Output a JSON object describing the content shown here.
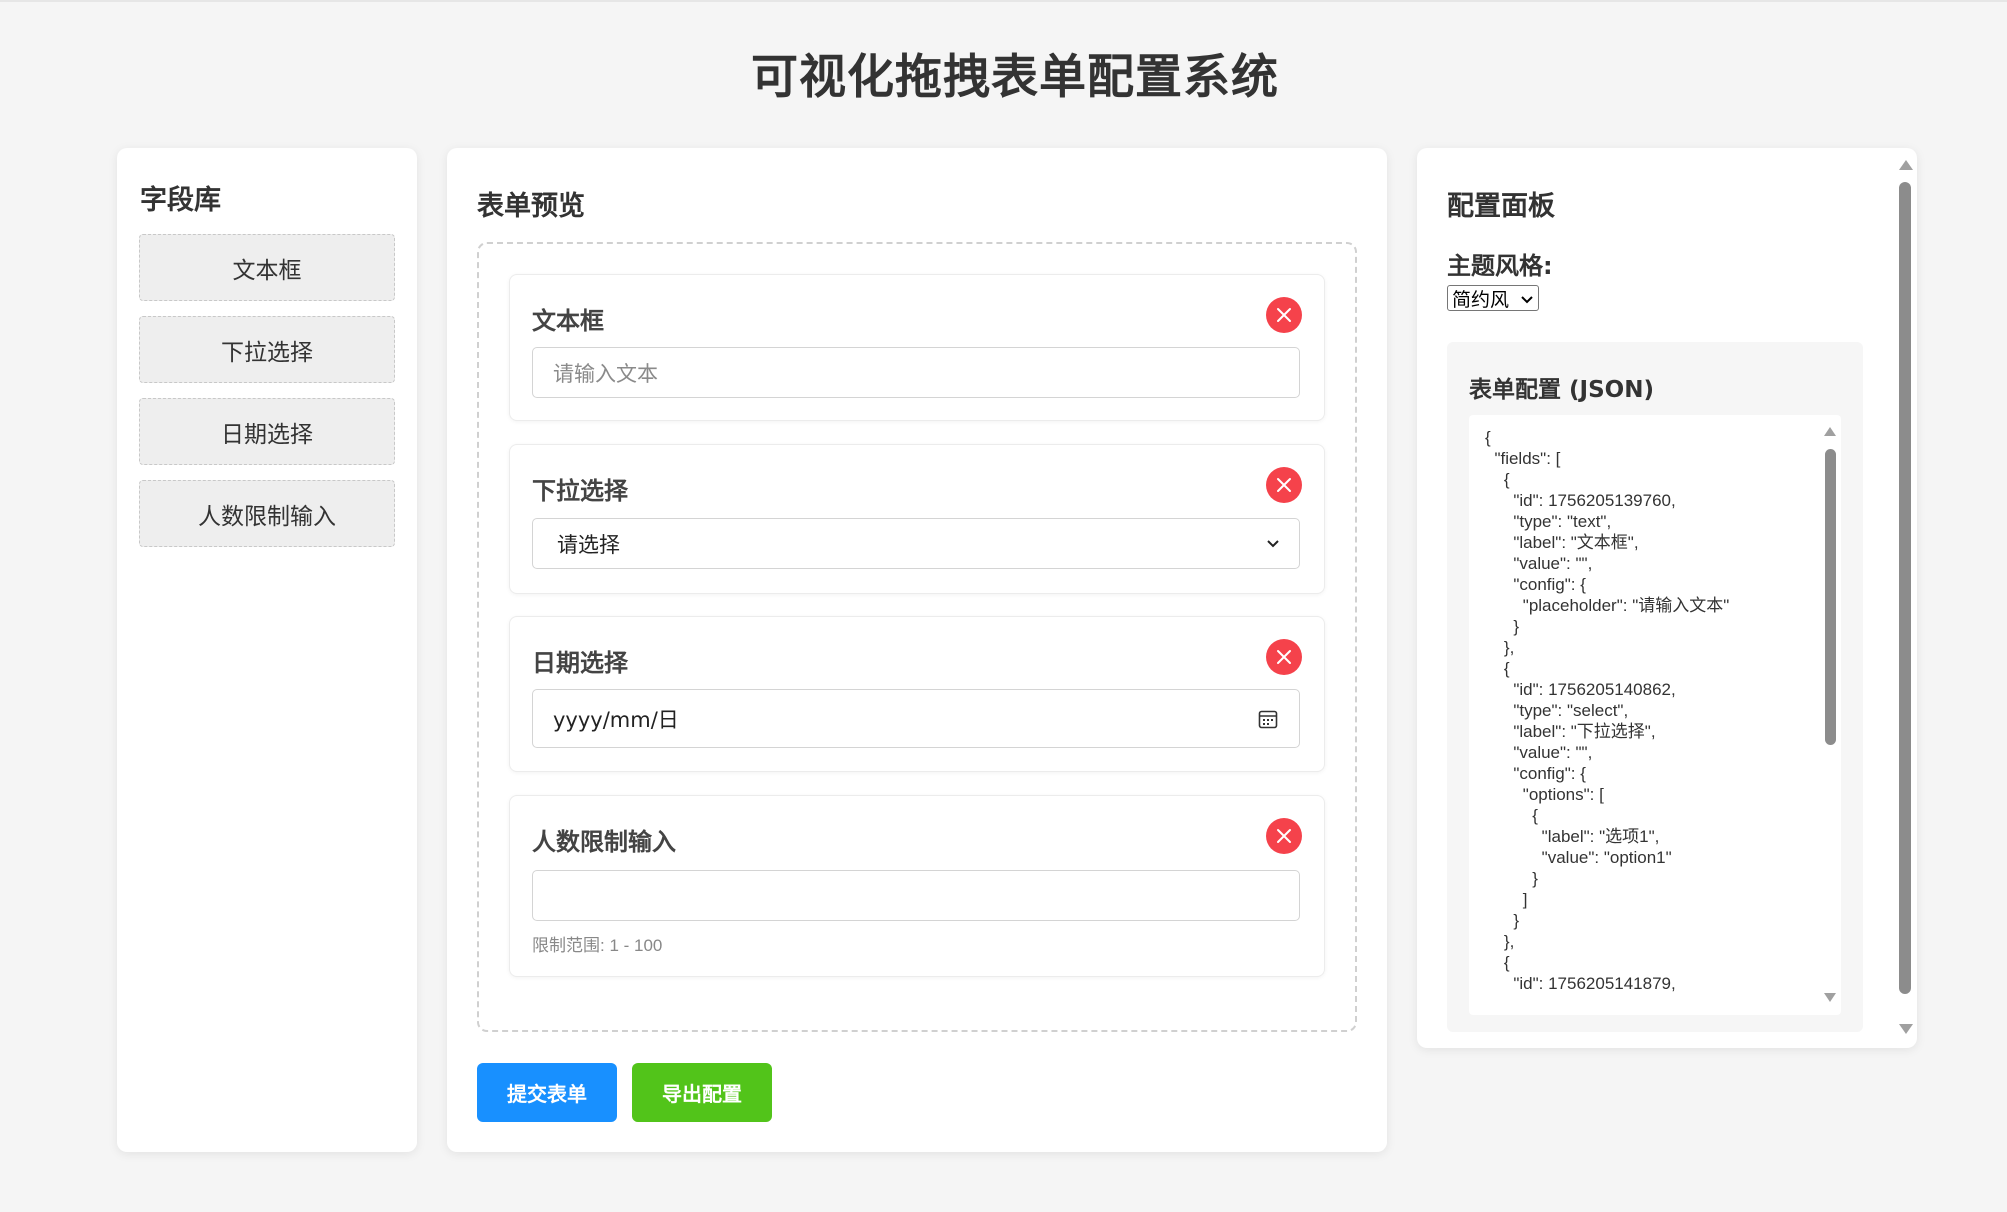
{
  "app": {
    "title": "可视化拖拽表单配置系统"
  },
  "library": {
    "title": "字段库",
    "items": [
      {
        "label": "文本框"
      },
      {
        "label": "下拉选择"
      },
      {
        "label": "日期选择"
      },
      {
        "label": "人数限制输入"
      }
    ]
  },
  "preview": {
    "title": "表单预览",
    "fields": [
      {
        "label": "文本框",
        "placeholder": "请输入文本"
      },
      {
        "label": "下拉选择",
        "selected": "请选择"
      },
      {
        "label": "日期选择",
        "value": "yyyy/mm/日"
      },
      {
        "label": "人数限制输入",
        "value": "",
        "hint": "限制范围: 1 - 100"
      }
    ],
    "submit_label": "提交表单",
    "export_label": "导出配置"
  },
  "config": {
    "title": "配置面板",
    "theme_label": "主题风格:",
    "theme_value": "简约风",
    "json_title": "表单配置 (JSON)",
    "json_text": "{\n  \"fields\": [\n    {\n      \"id\": 1756205139760,\n      \"type\": \"text\",\n      \"label\": \"文本框\",\n      \"value\": \"\",\n      \"config\": {\n        \"placeholder\": \"请输入文本\"\n      }\n    },\n    {\n      \"id\": 1756205140862,\n      \"type\": \"select\",\n      \"label\": \"下拉选择\",\n      \"value\": \"\",\n      \"config\": {\n        \"options\": [\n          {\n            \"label\": \"选项1\",\n            \"value\": \"option1\"\n          }\n        ]\n      }\n    },\n    {\n      \"id\": 1756205141879,"
  },
  "colors": {
    "primary": "#1890ff",
    "success": "#52c41a",
    "danger": "#f5424b"
  }
}
